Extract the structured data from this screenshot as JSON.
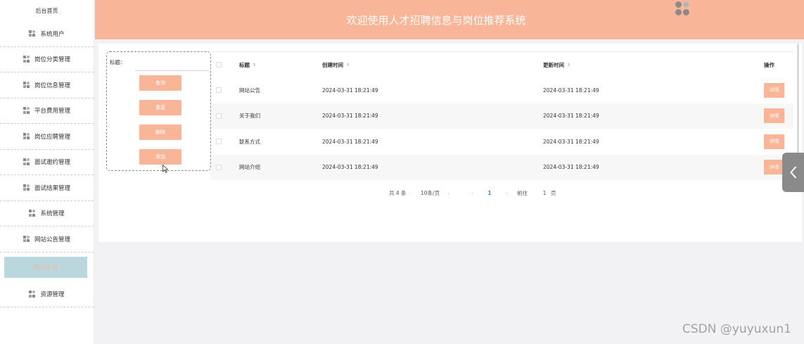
{
  "header": {
    "title": "欢迎使用人才招聘信息与岗位推荐系统",
    "logo_icon": "app-logo-icon"
  },
  "sidebar": {
    "home_label": "后台首页",
    "items": [
      {
        "label": "系统用户",
        "icon": "menu-icon"
      },
      {
        "label": "岗位分类管理",
        "icon": "menu-icon"
      },
      {
        "label": "岗位信息管理",
        "icon": "menu-icon"
      },
      {
        "label": "平台费用管理",
        "icon": "menu-icon"
      },
      {
        "label": "岗位应聘管理",
        "icon": "menu-icon"
      },
      {
        "label": "面试邀约管理",
        "icon": "menu-icon"
      },
      {
        "label": "面试结果管理",
        "icon": "menu-icon"
      },
      {
        "label": "系统管理",
        "icon": "menu-icon"
      },
      {
        "label": "网站公告管理",
        "icon": "menu-icon"
      }
    ],
    "active_sub_label": "网站公告",
    "bottom_item": {
      "label": "资源管理",
      "icon": "menu-icon"
    }
  },
  "panel": {
    "title_label": "标题：",
    "title_value": "",
    "buttons": {
      "query": "查询",
      "reset": "重置",
      "delete": "删除",
      "add": "添加"
    }
  },
  "table": {
    "columns": {
      "title": "标题",
      "created": "创建时间",
      "updated": "更新时间",
      "op": "操作"
    },
    "rows": [
      {
        "title": "网站公告",
        "created": "2024-03-31 18:21:49",
        "updated": "2024-03-31 18:21:49",
        "action": "详情"
      },
      {
        "title": "关于我们",
        "created": "2024-03-31 18:21:49",
        "updated": "2024-03-31 18:21:49",
        "action": "详情"
      },
      {
        "title": "联系方式",
        "created": "2024-03-31 18:21:49",
        "updated": "2024-03-31 18:21:49",
        "action": "详情"
      },
      {
        "title": "网站介绍",
        "created": "2024-03-31 18:21:49",
        "updated": "2024-03-31 18:21:49",
        "action": "详情"
      }
    ]
  },
  "pagination": {
    "total_text": "共 4 条",
    "page_size": "10条/页",
    "prev_icon": "‹",
    "current_page": "1",
    "next_icon": "›",
    "goto_label": "前往",
    "goto_value": "1",
    "page_unit": "页"
  },
  "watermark": "CSDN @yuyuxun1",
  "colors": {
    "accent": "#f8b598",
    "sub_active_bg": "#b9d7dd",
    "page_bg": "#f2f2f5",
    "pager_active": "#3a8ee6"
  }
}
